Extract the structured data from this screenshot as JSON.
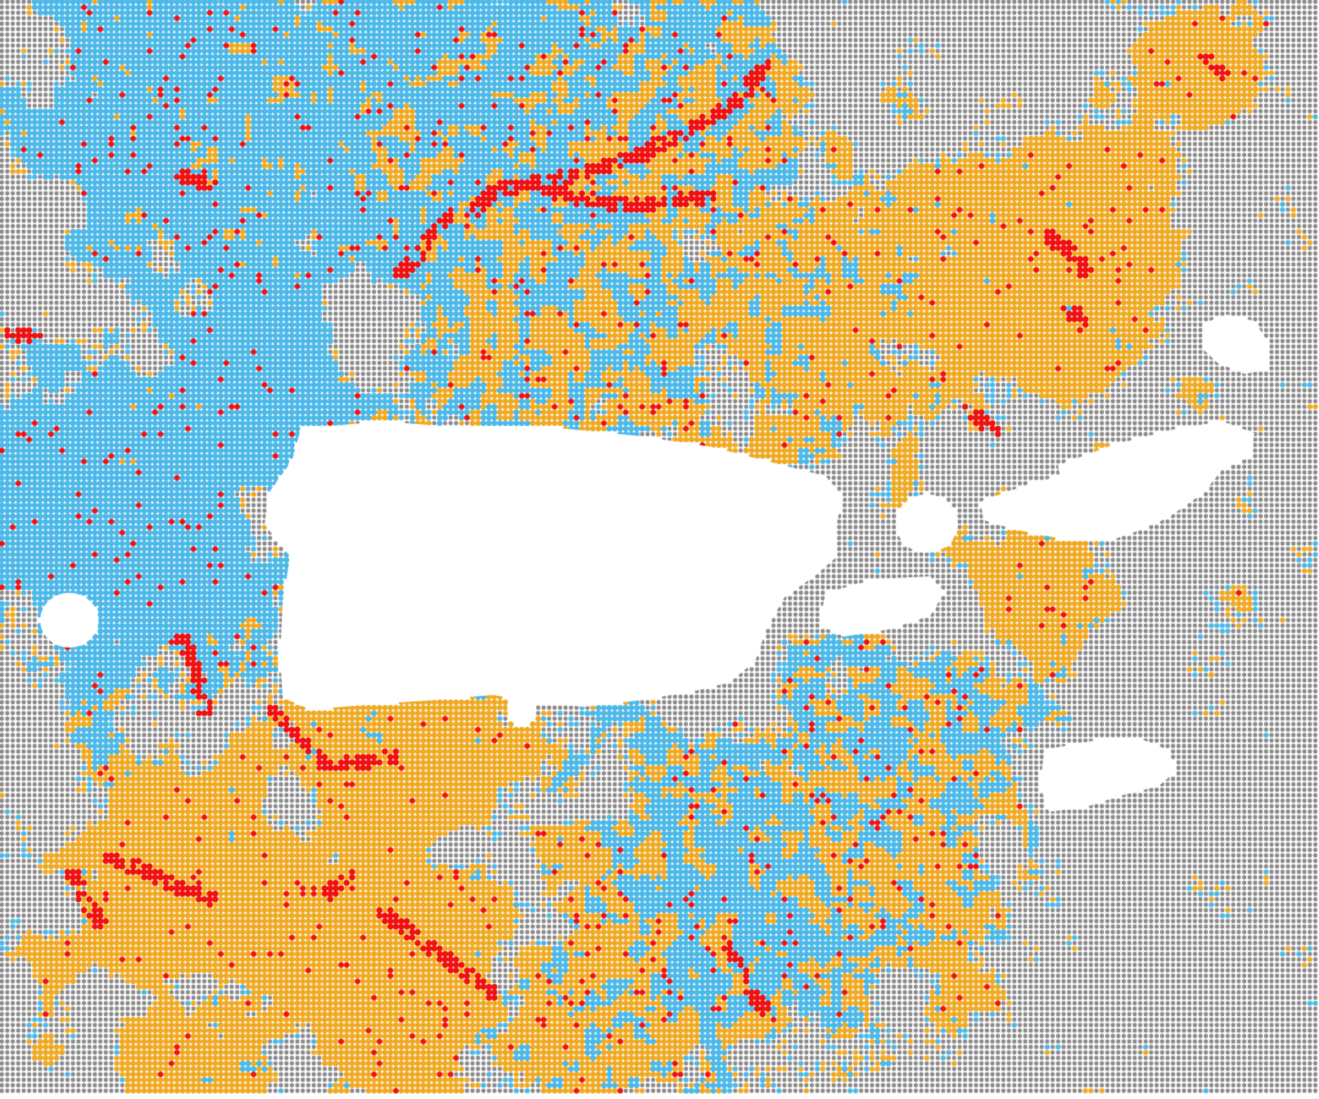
{
  "map": {
    "background_color": "#ffffff",
    "grid_dot_color": "#8c8c8c",
    "land_mask_color": "#ffffff",
    "categories": [
      {
        "name": "category-gray",
        "color": "#8c8c8c"
      },
      {
        "name": "category-blue",
        "color": "#4cb8e8"
      },
      {
        "name": "category-orange",
        "color": "#f0a820"
      },
      {
        "name": "category-red",
        "color": "#f01010"
      }
    ],
    "features": [
      "puerto-rico-island",
      "mona-island",
      "caja-de-muertos-island",
      "vieques-island",
      "culebra-island",
      "st-thomas-island",
      "st-john-island",
      "tortola-island",
      "st-croix-island"
    ]
  }
}
